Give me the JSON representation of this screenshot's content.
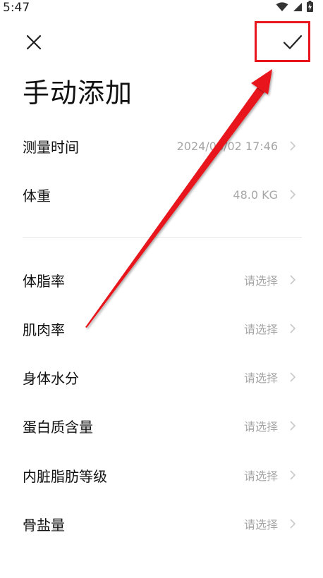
{
  "status_bar": {
    "time": "5:47",
    "icons": [
      "wifi-icon",
      "signal-icon",
      "battery-charging-icon"
    ]
  },
  "toolbar": {
    "close_icon": "close-icon",
    "confirm_icon": "checkmark-icon"
  },
  "title": "手动添加",
  "primary_rows": [
    {
      "label": "测量时间",
      "value": "2024/08/02 17:46"
    },
    {
      "label": "体重",
      "value": "48.0 KG"
    }
  ],
  "secondary_rows": [
    {
      "label": "体脂率",
      "value": "请选择"
    },
    {
      "label": "肌肉率",
      "value": "请选择"
    },
    {
      "label": "身体水分",
      "value": "请选择"
    },
    {
      "label": "蛋白质含量",
      "value": "请选择"
    },
    {
      "label": "内脏脂肪等级",
      "value": "请选择"
    },
    {
      "label": "骨盐量",
      "value": "请选择"
    }
  ],
  "colors": {
    "annotation_red": "#e8161c",
    "value_gray": "#a6a6a6",
    "chevron_gray": "#c8c8c8"
  }
}
